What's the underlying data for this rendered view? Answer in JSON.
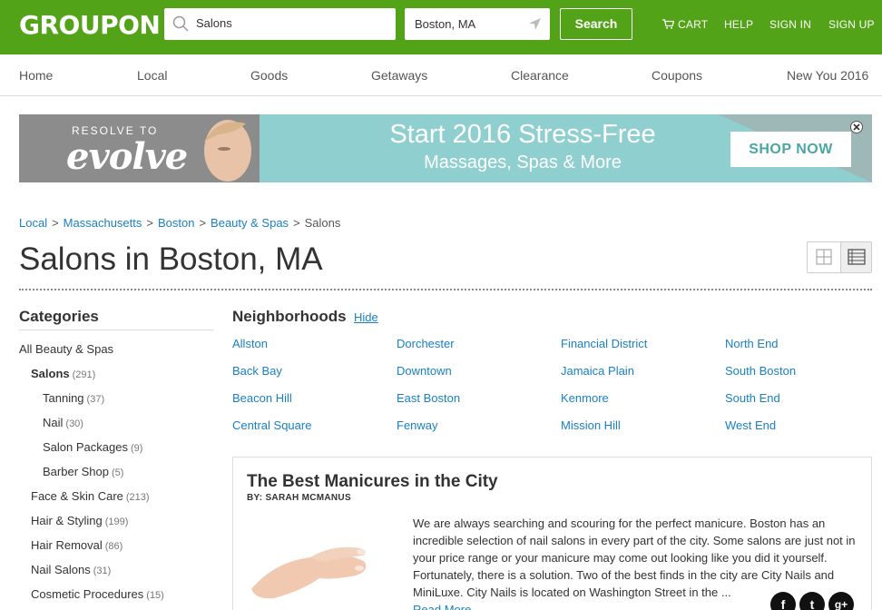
{
  "header": {
    "logo": "GROUPON",
    "search_value": "Salons",
    "location_value": "Boston, MA",
    "search_button": "Search",
    "links": {
      "cart": "CART",
      "help": "HELP",
      "sign_in": "SIGN IN",
      "sign_up": "SIGN UP"
    }
  },
  "nav": [
    "Home",
    "Local",
    "Goods",
    "Getaways",
    "Clearance",
    "Coupons",
    "New You 2016"
  ],
  "banner": {
    "resolve": "RESOLVE TO",
    "evolve": "evolve",
    "headline": "Start 2016 Stress-Free",
    "subline": "Massages, Spas & More",
    "cta": "SHOP NOW"
  },
  "breadcrumb": [
    "Local",
    "Massachusetts",
    "Boston",
    "Beauty & Spas",
    "Salons"
  ],
  "page_title": "Salons in Boston, MA",
  "categories": {
    "title": "Categories",
    "items": [
      {
        "label": "All Beauty & Spas",
        "count": ""
      },
      {
        "label": "Salons",
        "count": "(291)"
      },
      {
        "label": "Tanning",
        "count": "(37)"
      },
      {
        "label": "Nail",
        "count": "(30)"
      },
      {
        "label": "Salon Packages",
        "count": "(9)"
      },
      {
        "label": "Barber Shop",
        "count": "(5)"
      },
      {
        "label": "Face & Skin Care",
        "count": "(213)"
      },
      {
        "label": "Hair & Styling",
        "count": "(199)"
      },
      {
        "label": "Hair Removal",
        "count": "(86)"
      },
      {
        "label": "Nail Salons",
        "count": "(31)"
      },
      {
        "label": "Cosmetic Procedures",
        "count": "(15)"
      }
    ]
  },
  "neighborhoods": {
    "title": "Neighborhoods",
    "hide": "Hide",
    "items": [
      "Allston",
      "Dorchester",
      "Financial District",
      "North End",
      "Back Bay",
      "Downtown",
      "Jamaica Plain",
      "South Boston",
      "Beacon Hill",
      "East Boston",
      "Kenmore",
      "South End",
      "Central Square",
      "Fenway",
      "Mission Hill",
      "West End"
    ]
  },
  "article": {
    "title": "The Best Manicures in the City",
    "byline": "BY: SARAH MCMANUS",
    "body": "We are always searching and scouring for the perfect manicure. Boston has an incredible selection of nail salons in every part of the city. Some salons are just not in your price range or your manicure may come out looking like you did it yourself. Fortunately, there is a solution. Two of the best finds in the city are City Nails and MiniLuxe. City Nails is located on Washington Street in the ...",
    "read_more": "Read More"
  },
  "social": {
    "facebook": "f",
    "twitter": "t",
    "google_plus": "g+"
  },
  "colors": {
    "brand_green": "#53a318",
    "link_blue": "#1a80c4",
    "banner_teal": "#8fcfcf"
  }
}
